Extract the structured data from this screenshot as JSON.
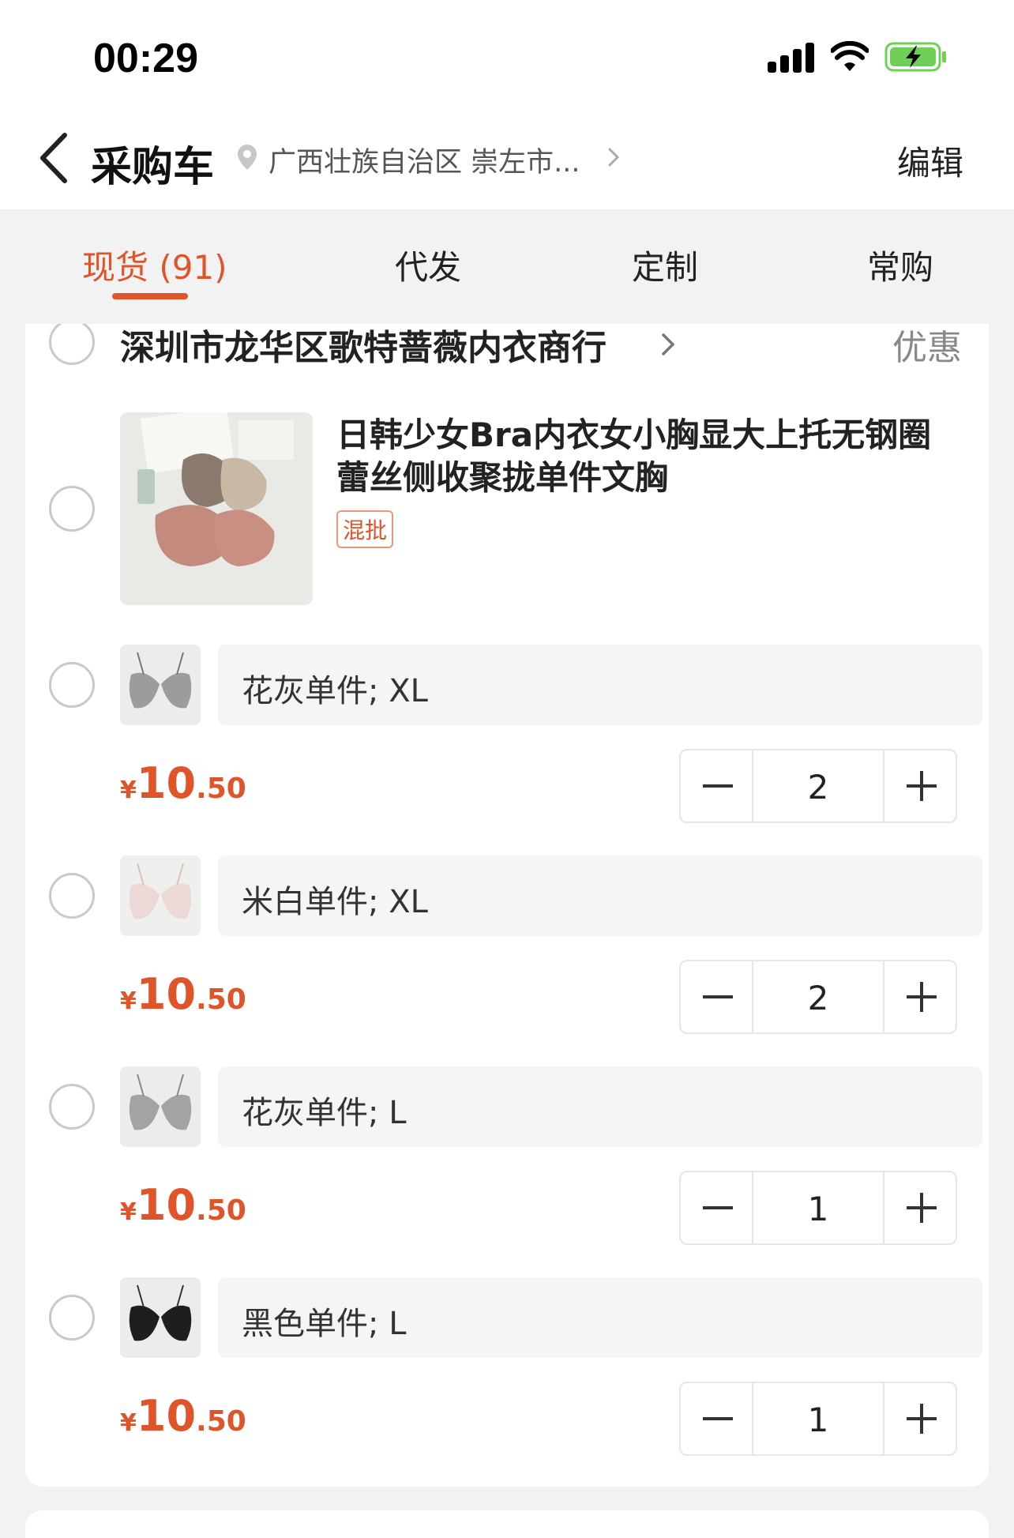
{
  "status_bar": {
    "time": "00:29"
  },
  "nav": {
    "title": "采购车",
    "location": "广西壮族自治区 崇左市...",
    "edit_label": "编辑"
  },
  "tabs": [
    {
      "label": "现货 (91)",
      "active": true
    },
    {
      "label": "代发",
      "active": false
    },
    {
      "label": "定制",
      "active": false
    },
    {
      "label": "常购",
      "active": false
    }
  ],
  "shop": {
    "name": "深圳市龙华区歌特蔷薇内衣商行",
    "promo_label": "优惠"
  },
  "product": {
    "title": "日韩少女Bra内衣女小胸显大上托无钢圈蕾丝侧收聚拢单件文胸",
    "tag": "混批"
  },
  "skus": [
    {
      "spec": "花灰单件; XL",
      "currency": "¥",
      "price_int": "10",
      "price_dec": ".50",
      "quantity": "2",
      "swatch": "#9c9c9c"
    },
    {
      "spec": "米白单件; XL",
      "currency": "¥",
      "price_int": "10",
      "price_dec": ".50",
      "quantity": "2",
      "swatch": "#ecd9d6"
    },
    {
      "spec": "花灰单件; L",
      "currency": "¥",
      "price_int": "10",
      "price_dec": ".50",
      "quantity": "1",
      "swatch": "#a3a3a3"
    },
    {
      "spec": "黑色单件; L",
      "currency": "¥",
      "price_int": "10",
      "price_dec": ".50",
      "quantity": "1",
      "swatch": "#1e1e1e"
    }
  ],
  "colors": {
    "accent": "#e0542a",
    "background": "#f2f2f2"
  }
}
